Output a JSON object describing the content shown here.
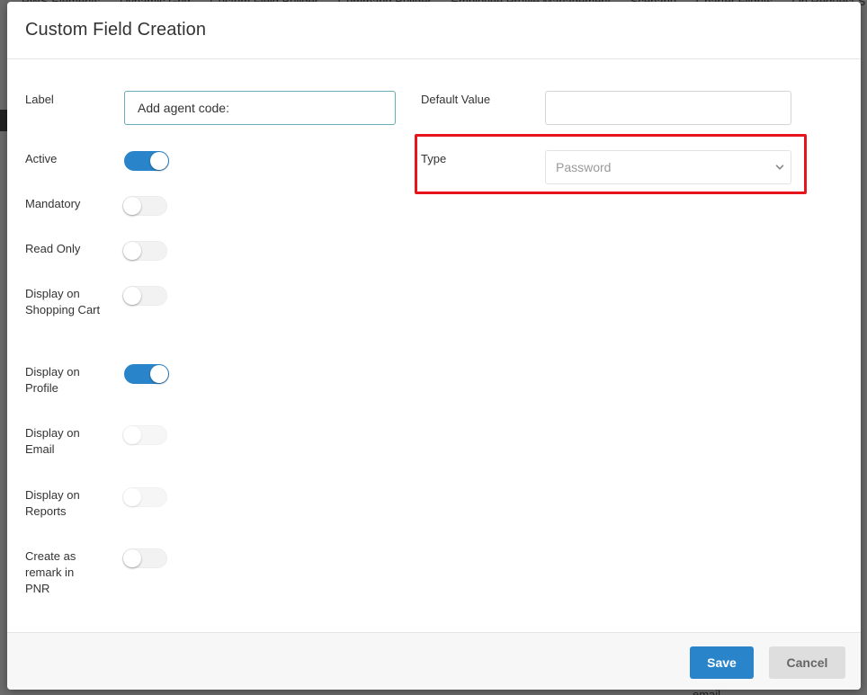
{
  "background": {
    "nav_items": [
      "PWS Elements",
      "Dynamic Grid",
      "Custom Field Builder",
      "Command Builder",
      "Employee Profile Management",
      "Scenario",
      "Charter Flights",
      "On Request S"
    ],
    "bottom_text": "email"
  },
  "modal": {
    "title": "Custom Field Creation",
    "fields": {
      "label": {
        "label": "Label",
        "value": "Add agent code:"
      },
      "default_value": {
        "label": "Default Value",
        "value": ""
      },
      "type": {
        "label": "Type",
        "selected": "Password"
      }
    },
    "toggles": [
      {
        "label": "Active",
        "on": true
      },
      {
        "label": "Mandatory",
        "on": false
      },
      {
        "label": "Read Only",
        "on": false
      },
      {
        "label": "Display on Shopping Cart",
        "on": false
      },
      {
        "label": "Display on Profile",
        "on": true
      },
      {
        "label": "Display on Email",
        "on": false
      },
      {
        "label": "Display on Reports",
        "on": false
      },
      {
        "label": "Create as remark in PNR",
        "on": false
      }
    ],
    "footer": {
      "save_label": "Save",
      "cancel_label": "Cancel"
    }
  },
  "colors": {
    "accent": "#2a84c9",
    "highlight": "#e8141b"
  }
}
